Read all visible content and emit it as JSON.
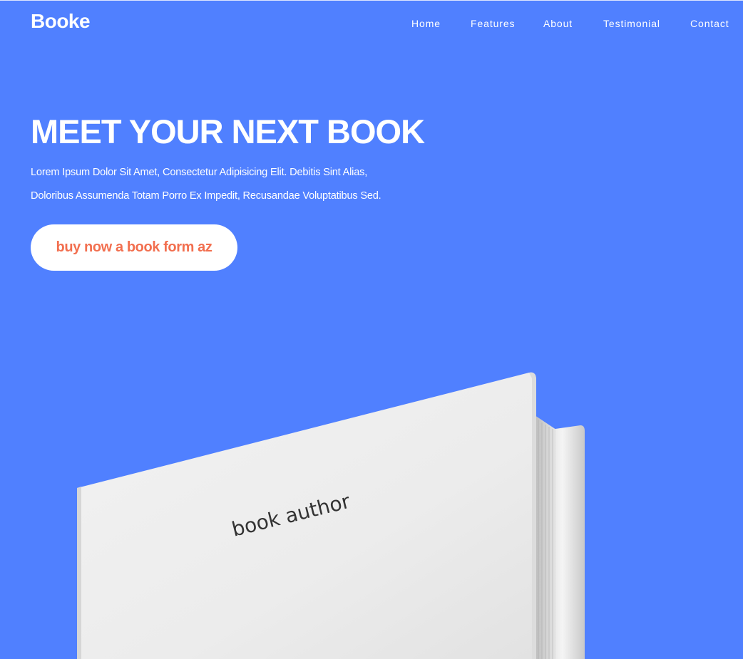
{
  "nav": {
    "logo": "Booke",
    "links": [
      "Home",
      "Features",
      "About",
      "Testimonial",
      "Contact"
    ]
  },
  "hero": {
    "title": "MEET YOUR NEXT BOOK",
    "description_lines": [
      "Lorem Ipsum Dolor Sit Amet, Consectetur Adipisicing Elit. Debitis Sint Alias,",
      "Doloribus Assumenda Totam Porro Ex Impedit, Recusandae Voluptatibus Sed."
    ],
    "cta_label": "buy now a book form az"
  },
  "book": {
    "cover_text": "book author"
  },
  "colors": {
    "background": "#5080ff",
    "cta_text": "#f26f4f",
    "cta_background": "#ffffff",
    "text": "#ffffff"
  }
}
